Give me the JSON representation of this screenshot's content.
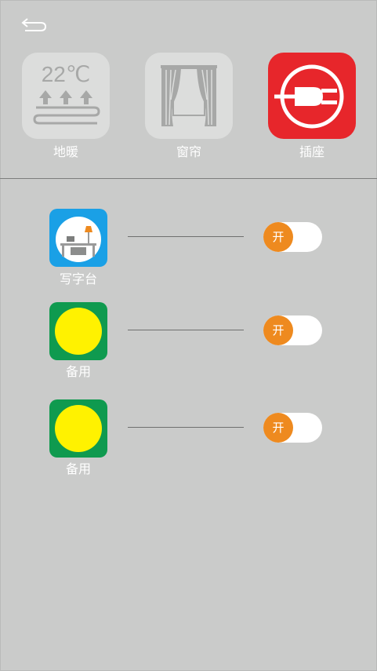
{
  "header": {
    "back_icon": "back-arrow-icon"
  },
  "categories": [
    {
      "label": "地暖",
      "temp_text": "22℃",
      "icon": "floor-heating-icon",
      "active": false
    },
    {
      "label": "窗帘",
      "icon": "curtain-icon",
      "active": false
    },
    {
      "label": "插座",
      "icon": "plug-icon",
      "active": true
    }
  ],
  "devices": [
    {
      "label": "写字台",
      "icon": "desk-icon",
      "toggle_text": "开"
    },
    {
      "label": "备用",
      "icon": "yellow-circle-icon",
      "toggle_text": "开"
    },
    {
      "label": "备用",
      "icon": "yellow-circle-icon",
      "toggle_text": "开"
    }
  ],
  "colors": {
    "background": "#cacbca",
    "tile_inactive": "#dcdddc",
    "tile_active": "#e7262b",
    "desk_icon_bg": "#1aa0e6",
    "spare_icon_bg": "#0f9a4f",
    "spare_circle": "#fff200",
    "toggle_knob": "#ee8a1f"
  }
}
